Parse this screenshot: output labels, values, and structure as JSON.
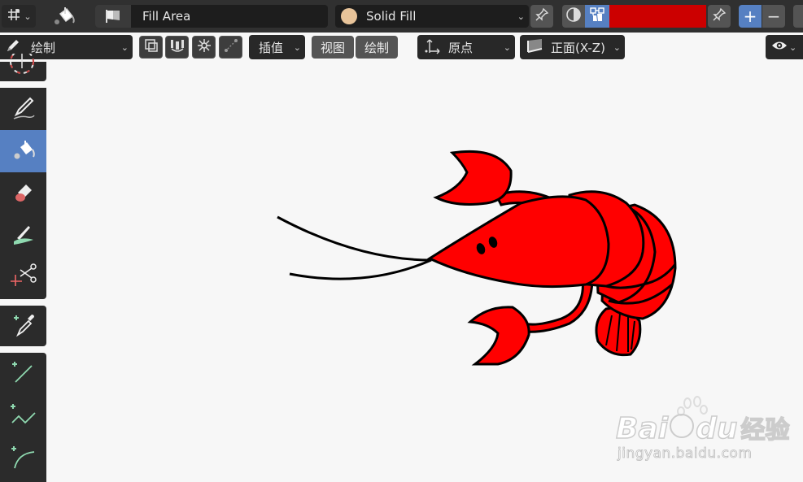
{
  "header": {
    "editor_type_icon": "grease-pencil-icon",
    "tool_icon": "paint-bucket-icon",
    "brush_name": "Fill Area",
    "material_name": "Solid Fill",
    "material_color": "#e8c49a",
    "active_color": "#cc0000",
    "add_label": "+",
    "remove_label": "−"
  },
  "toolbar_row": {
    "mode_label": "绘制",
    "interp_label": "插值",
    "view_label": "视图",
    "draw_label": "绘制",
    "origin_label": "原点",
    "plane_label": "正面(X-Z)"
  },
  "tools": [
    {
      "name": "cursor-tool",
      "icon": "cursor-icon"
    },
    {
      "name": "draw-tool",
      "icon": "pencil-icon"
    },
    {
      "name": "fill-tool",
      "icon": "paint-bucket-icon"
    },
    {
      "name": "erase-tool",
      "icon": "eraser-icon"
    },
    {
      "name": "tint-tool",
      "icon": "tint-brush-icon"
    },
    {
      "name": "cutter-tool",
      "icon": "scissors-icon"
    },
    {
      "name": "eyedropper-tool",
      "icon": "eyedropper-icon"
    },
    {
      "name": "line-tool",
      "icon": "line-icon"
    },
    {
      "name": "polyline-tool",
      "icon": "polyline-icon"
    },
    {
      "name": "arc-tool",
      "icon": "arc-icon"
    }
  ],
  "watermark": {
    "brand": "Bai",
    "brand2": "du",
    "suffix": "经验",
    "url": "jingyan.baidu.com"
  },
  "colors": {
    "fill_red": "#ff0000",
    "outline": "#000000",
    "accent_blue": "#5680c2"
  }
}
